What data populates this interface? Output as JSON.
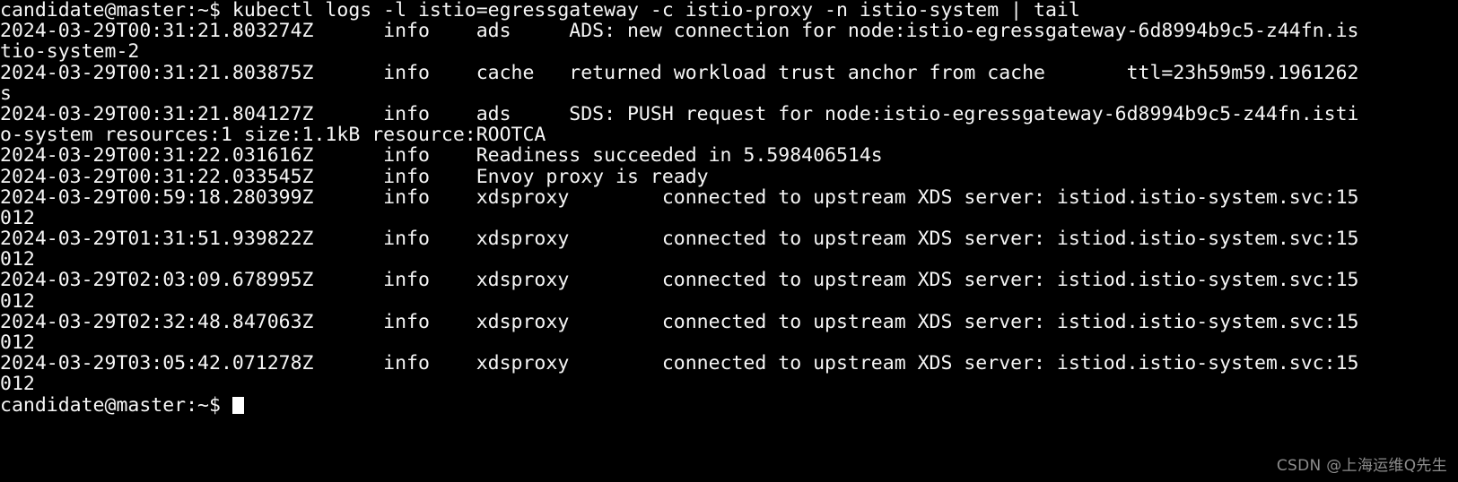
{
  "terminal": {
    "title": "candidate@master terminal",
    "background_color": "#000000",
    "foreground_color": "#f6f6f6",
    "cursor_color": "#ffffff",
    "columns": 122,
    "rows": 20,
    "prompt": "candidate@master:~$",
    "command": "kubectl logs -l istio=egressgateway -c istio-proxy -n istio-system | tail",
    "command_line": "candidate@master:~$ kubectl logs -l istio=egressgateway -c istio-proxy -n istio-system | tail",
    "final_prompt": "candidate@master:~$",
    "lines": [
      "candidate@master:~$ kubectl logs -l istio=egressgateway -c istio-proxy -n istio-system | tail",
      "2024-03-29T00:31:21.803274Z\tinfo\tads\tADS: new connection for node:istio-egressgateway-6d8994b9c5-z44fn.is",
      "tio-system-2",
      "2024-03-29T00:31:21.803875Z\tinfo\tcache\treturned workload trust anchor from cache\tttl=23h59m59.1961262",
      "s",
      "2024-03-29T00:31:21.804127Z\tinfo\tads\tSDS: PUSH request for node:istio-egressgateway-6d8994b9c5-z44fn.isti",
      "o-system resources:1 size:1.1kB resource:ROOTCA",
      "2024-03-29T00:31:22.031616Z\tinfo\tReadiness succeeded in 5.598406514s",
      "2024-03-29T00:31:22.033545Z\tinfo\tEnvoy proxy is ready",
      "2024-03-29T00:59:18.280399Z\tinfo\txdsproxy\tconnected to upstream XDS server: istiod.istio-system.svc:15",
      "012",
      "2024-03-29T01:31:51.939822Z\tinfo\txdsproxy\tconnected to upstream XDS server: istiod.istio-system.svc:15",
      "012",
      "2024-03-29T02:03:09.678995Z\tinfo\txdsproxy\tconnected to upstream XDS server: istiod.istio-system.svc:15",
      "012",
      "2024-03-29T02:32:48.847063Z\tinfo\txdsproxy\tconnected to upstream XDS server: istiod.istio-system.svc:15",
      "012",
      "2024-03-29T03:05:42.071278Z\tinfo\txdsproxy\tconnected to upstream XDS server: istiod.istio-system.svc:15",
      "012",
      "candidate@master:~$ "
    ],
    "rendered_lines": [
      "candidate@master:~$ kubectl logs -l istio=egressgateway -c istio-proxy -n istio-system | tail",
      "2024-03-29T00:31:21.803274Z      info    ads     ADS: new connection for node:istio-egressgateway-6d8994b9c5-z44fn.is",
      "tio-system-2",
      "2024-03-29T00:31:21.803875Z      info    cache   returned workload trust anchor from cache       ttl=23h59m59.1961262",
      "s",
      "2024-03-29T00:31:21.804127Z      info    ads     SDS: PUSH request for node:istio-egressgateway-6d8994b9c5-z44fn.isti",
      "o-system resources:1 size:1.1kB resource:ROOTCA",
      "2024-03-29T00:31:22.031616Z      info    Readiness succeeded in 5.598406514s",
      "2024-03-29T00:31:22.033545Z      info    Envoy proxy is ready",
      "2024-03-29T00:59:18.280399Z      info    xdsproxy        connected to upstream XDS server: istiod.istio-system.svc:15",
      "012",
      "2024-03-29T01:31:51.939822Z      info    xdsproxy        connected to upstream XDS server: istiod.istio-system.svc:15",
      "012",
      "2024-03-29T02:03:09.678995Z      info    xdsproxy        connected to upstream XDS server: istiod.istio-system.svc:15",
      "012",
      "2024-03-29T02:32:48.847063Z      info    xdsproxy        connected to upstream XDS server: istiod.istio-system.svc:15",
      "012",
      "2024-03-29T03:05:42.071278Z      info    xdsproxy        connected to upstream XDS server: istiod.istio-system.svc:15",
      "012",
      "candidate@master:~$ "
    ],
    "log_entries": [
      {
        "timestamp": "2024-03-29T00:31:21.803274Z",
        "level": "info",
        "scope": "ads",
        "message": "ADS: new connection for node:istio-egressgateway-6d8994b9c5-z44fn.istio-system-2"
      },
      {
        "timestamp": "2024-03-29T00:31:21.803875Z",
        "level": "info",
        "scope": "cache",
        "message": "returned workload trust anchor from cache",
        "extra": "ttl=23h59m59.1961262s"
      },
      {
        "timestamp": "2024-03-29T00:31:21.804127Z",
        "level": "info",
        "scope": "ads",
        "message": "SDS: PUSH request for node:istio-egressgateway-6d8994b9c5-z44fn.istio-system resources:1 size:1.1kB resource:ROOTCA"
      },
      {
        "timestamp": "2024-03-29T00:31:22.031616Z",
        "level": "info",
        "scope": "",
        "message": "Readiness succeeded in 5.598406514s"
      },
      {
        "timestamp": "2024-03-29T00:31:22.033545Z",
        "level": "info",
        "scope": "",
        "message": "Envoy proxy is ready"
      },
      {
        "timestamp": "2024-03-29T00:59:18.280399Z",
        "level": "info",
        "scope": "xdsproxy",
        "message": "connected to upstream XDS server: istiod.istio-system.svc:15012"
      },
      {
        "timestamp": "2024-03-29T01:31:51.939822Z",
        "level": "info",
        "scope": "xdsproxy",
        "message": "connected to upstream XDS server: istiod.istio-system.svc:15012"
      },
      {
        "timestamp": "2024-03-29T02:03:09.678995Z",
        "level": "info",
        "scope": "xdsproxy",
        "message": "connected to upstream XDS server: istiod.istio-system.svc:15012"
      },
      {
        "timestamp": "2024-03-29T02:32:48.847063Z",
        "level": "info",
        "scope": "xdsproxy",
        "message": "connected to upstream XDS server: istiod.istio-system.svc:15012"
      },
      {
        "timestamp": "2024-03-29T03:05:42.071278Z",
        "level": "info",
        "scope": "xdsproxy",
        "message": "connected to upstream XDS server: istiod.istio-system.svc:15012"
      }
    ]
  },
  "watermark": {
    "text": "CSDN @上海运维Q先生",
    "color": "#8d8d8d"
  }
}
